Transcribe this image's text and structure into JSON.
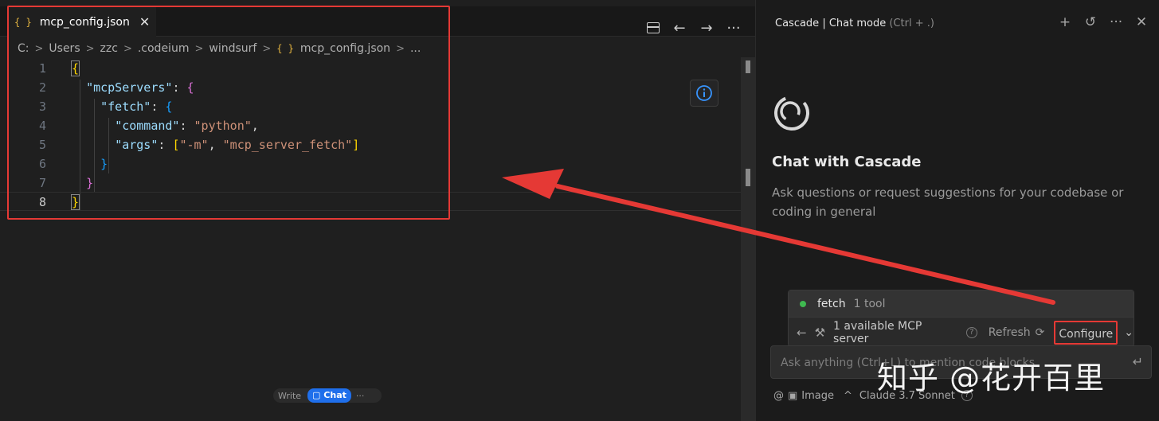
{
  "editor": {
    "tab": {
      "icon": "{ }",
      "label": "mcp_config.json",
      "close": "✕"
    },
    "actions": [
      "split-editor-icon",
      "back-icon",
      "forward-icon",
      "more-icon"
    ],
    "breadcrumb": [
      "C:",
      "Users",
      "zzc",
      ".codeium",
      "windsurf",
      "mcp_config.json",
      "..."
    ],
    "lines": [
      {
        "num": "1"
      },
      {
        "num": "2"
      },
      {
        "num": "3"
      },
      {
        "num": "4"
      },
      {
        "num": "5"
      },
      {
        "num": "6"
      },
      {
        "num": "7"
      },
      {
        "num": "8"
      }
    ],
    "code": {
      "key_mcpServers": "\"mcpServers\"",
      "key_fetch": "\"fetch\"",
      "key_command": "\"command\"",
      "val_command": "\"python\"",
      "key_args": "\"args\"",
      "arg1": "\"-m\"",
      "arg2": "\"mcp_server_fetch\""
    }
  },
  "panel": {
    "title": "Cascade | Chat mode",
    "shortcut": "(Ctrl + .)",
    "heading": "Chat with Cascade",
    "subtitle": "Ask questions or request suggestions for your codebase or coding in general",
    "mcp": {
      "server_name": "fetch",
      "tool_count": "1 tool",
      "available": "1 available MCP server",
      "refresh": "Refresh",
      "configure": "Configure"
    },
    "input_placeholder": "Ask anything (Ctrl+L) to mention code blocks",
    "bottom": {
      "image": "Image",
      "model": "Claude 3.7 Sonnet",
      "write": "Write",
      "chat": "Chat",
      "more": "···"
    }
  },
  "watermark": "知乎 @花开百里",
  "colors": {
    "accent": "#1f6feb",
    "annotation_red": "#e53935",
    "status_green": "#3fb950"
  }
}
